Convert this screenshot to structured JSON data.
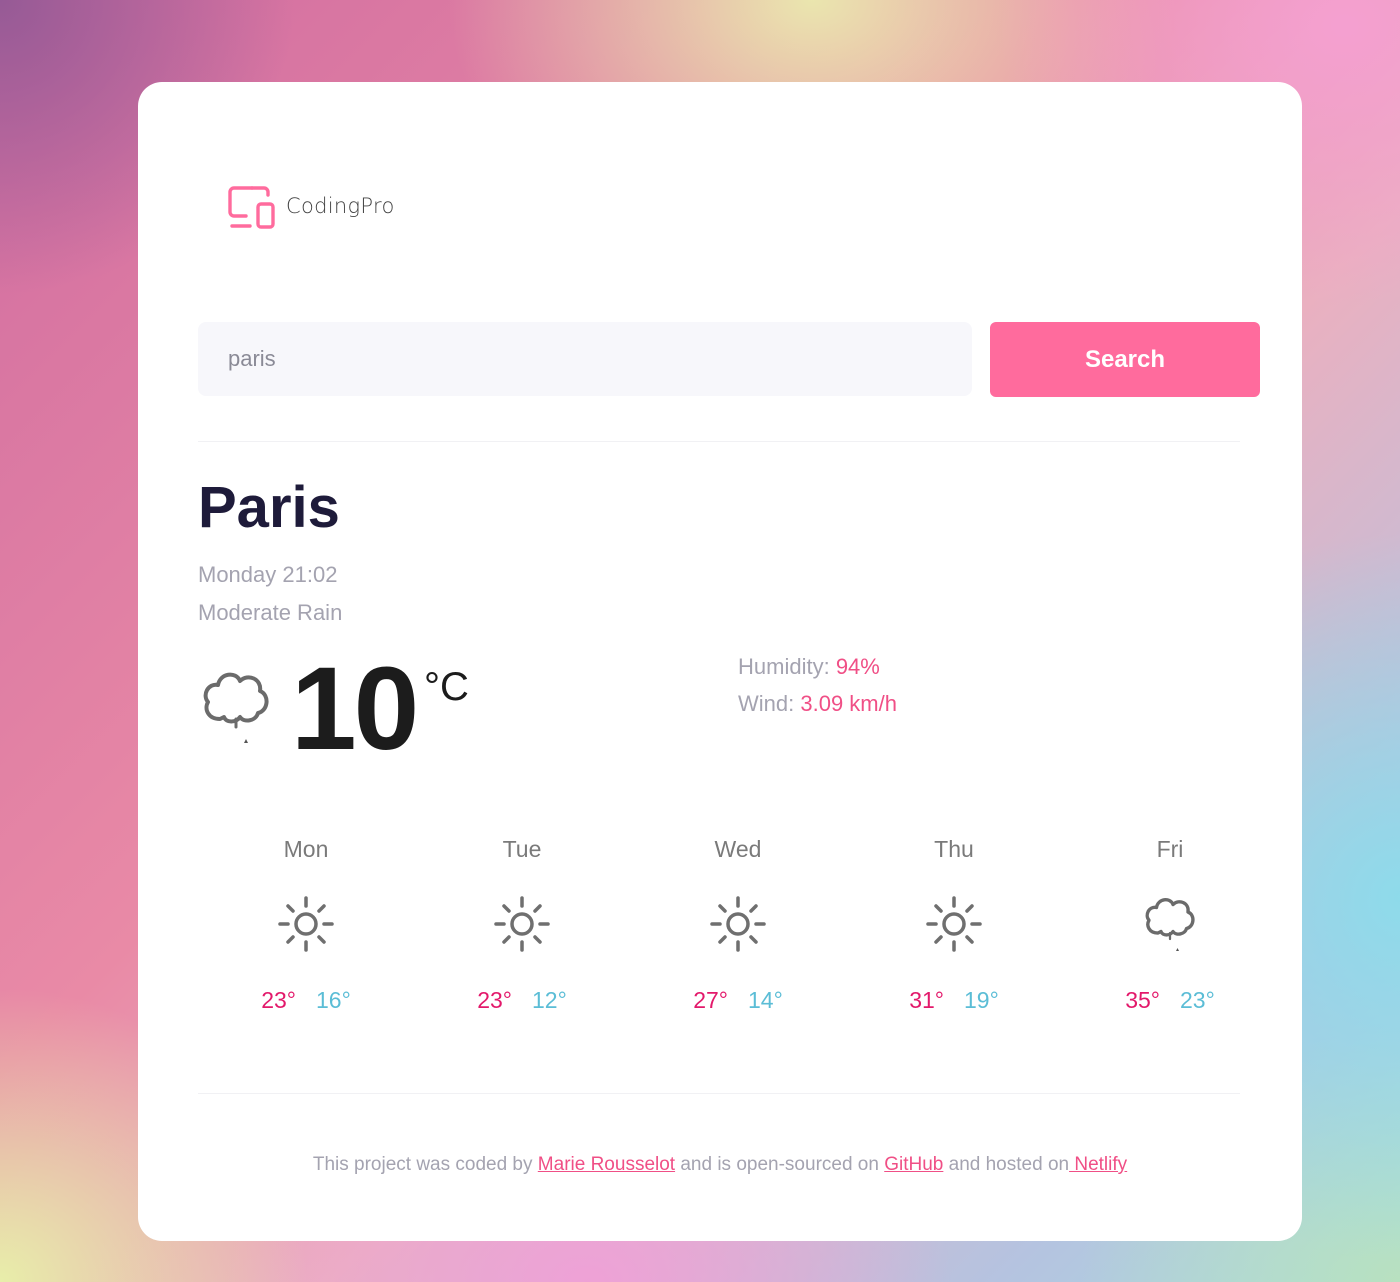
{
  "brand": {
    "name": "CodingPro",
    "accent": "#ff6b9d"
  },
  "search": {
    "value": "paris",
    "button_label": "Search"
  },
  "current": {
    "city": "Paris",
    "datetime": "Monday 21:02",
    "description": "Moderate Rain",
    "icon": "cloud-rain-icon",
    "temperature": "10",
    "unit": "°C",
    "humidity_label": "Humidity:",
    "humidity_value": "94%",
    "wind_label": "Wind:",
    "wind_value": "3.09 km/h"
  },
  "forecast": [
    {
      "day": "Mon",
      "icon": "sun-icon",
      "max": "23°",
      "min": "16°"
    },
    {
      "day": "Tue",
      "icon": "sun-icon",
      "max": "23°",
      "min": "12°"
    },
    {
      "day": "Wed",
      "icon": "sun-icon",
      "max": "27°",
      "min": "14°"
    },
    {
      "day": "Thu",
      "icon": "sun-icon",
      "max": "31°",
      "min": "19°"
    },
    {
      "day": "Fri",
      "icon": "cloud-rain-icon",
      "max": "35°",
      "min": "23°"
    }
  ],
  "footer": {
    "text1": "This project was coded by ",
    "author": "Marie Rousselot",
    "text2": " and is open-sourced on ",
    "github": "GitHub",
    "text3": " and hosted on",
    "netlify": " Netlify"
  },
  "colors": {
    "high": "#e3196b",
    "low": "#5bbdd6",
    "stat_value": "#f04f86"
  }
}
